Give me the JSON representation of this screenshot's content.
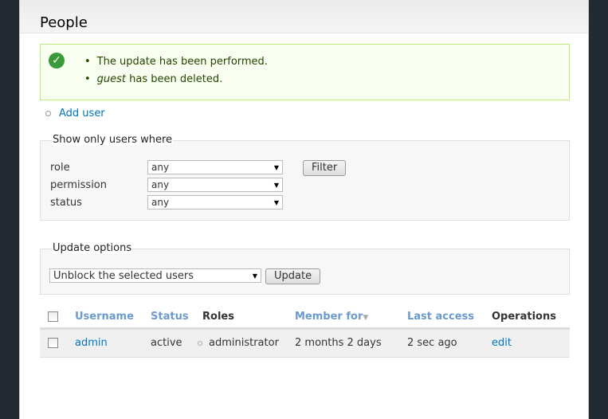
{
  "page": {
    "title": "People"
  },
  "messages": {
    "items": [
      "The update has been performed."
    ],
    "deleted_user": "guest",
    "deleted_suffix": " has been deleted."
  },
  "actions": {
    "add_user": "Add user"
  },
  "filter": {
    "legend": "Show only users where",
    "fields": [
      {
        "label": "role",
        "value": "any"
      },
      {
        "label": "permission",
        "value": "any"
      },
      {
        "label": "status",
        "value": "any"
      }
    ],
    "button": "Filter"
  },
  "update": {
    "legend": "Update options",
    "selected": "Unblock the selected users",
    "button": "Update"
  },
  "table": {
    "headers": [
      "Username",
      "Status",
      "Roles",
      "Member for",
      "Last access",
      "Operations"
    ],
    "rows": [
      {
        "username": "admin",
        "status": "active",
        "roles": "administrator",
        "member_for": "2 months 2 days",
        "last_access": "2 sec ago",
        "operation": "edit"
      }
    ]
  }
}
